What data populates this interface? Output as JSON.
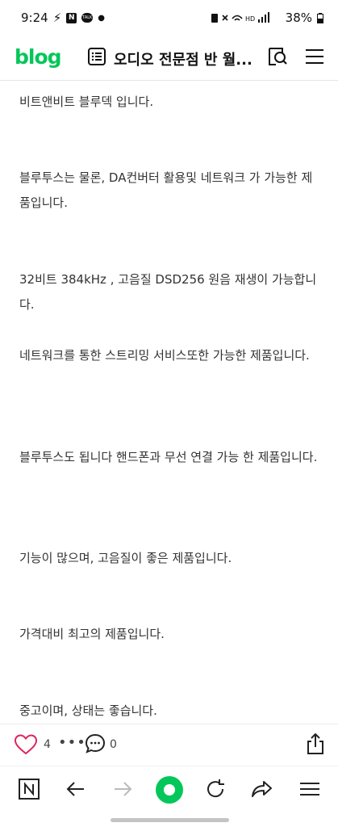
{
  "status_bar": {
    "time": "9:24",
    "app_badge": "N",
    "talk_badge": "TALK",
    "battery": "38%"
  },
  "header": {
    "logo": "blog",
    "title": "오디오 전문점 반 월..."
  },
  "content": {
    "paragraphs": [
      "비트앤비트 블루덱 입니다.",
      "블루투스는 물론, DA컨버터 활용및 네트워크 가 가능한 제품입니다.",
      "32비트 384kHz , 고음질 DSD256 원음 재생이 가능합니다.",
      "네트워크를 통한 스트리밍 서비스또한 가능한 제품입니다.",
      "블루투스도 됩니다  핸드폰과  무선 연결 가능 한 제품입니다.",
      "기능이 많으며,  고음질이 좋은 제품입니다.",
      "가격대비 최고의 제품입니다.",
      "중고이며, 상태는 좋습니다."
    ]
  },
  "actions": {
    "like_count": "4",
    "more": "•••",
    "comment_count": "0"
  },
  "colors": {
    "brand": "#03c75a",
    "like": "#e0245e"
  },
  "icons": {
    "header": [
      "list-icon",
      "search-icon",
      "menu-icon"
    ],
    "action_bar": [
      "heart-icon",
      "comment-icon",
      "share-icon"
    ],
    "bottom_nav": [
      "naver-n-icon",
      "back-arrow-icon",
      "forward-arrow-icon",
      "home-icon",
      "reload-icon",
      "share-arrow-icon",
      "menu-icon"
    ]
  }
}
